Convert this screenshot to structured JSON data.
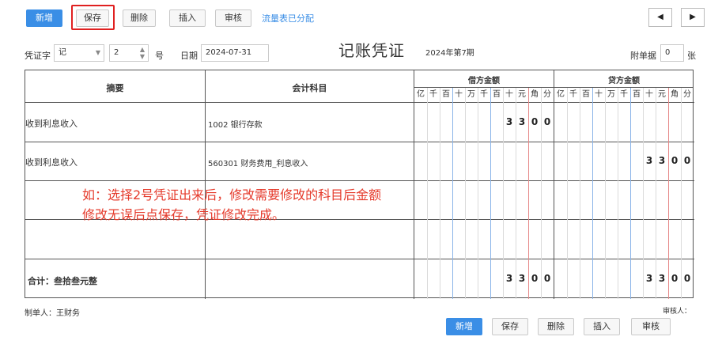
{
  "toolbar": {
    "new_label": "新增",
    "save_label": "保存",
    "delete_label": "删除",
    "insert_label": "插入",
    "review_label": "审核",
    "cashflow_link": "流量表已分配",
    "prev_icon": "◀",
    "next_icon": "▶"
  },
  "header": {
    "voucher_word_label": "凭证字",
    "voucher_word_value": "记",
    "number_value": "2",
    "number_suffix": "号",
    "date_label": "日期",
    "date_value": "2024-07-31",
    "title": "记账凭证",
    "period": "2024年第7期",
    "attachment_label": "附单据",
    "attachment_value": "0",
    "attachment_unit": "张"
  },
  "table": {
    "col_summary": "摘要",
    "col_account": "会计科目",
    "col_debit": "借方金额",
    "col_credit": "贷方金额",
    "units": [
      "亿",
      "千",
      "百",
      "十",
      "万",
      "千",
      "百",
      "十",
      "元",
      "角",
      "分"
    ],
    "rows": [
      {
        "summary": "收到利息收入",
        "account": "1002 银行存款",
        "debit_digits": [
          "3",
          "3",
          "0",
          "0"
        ],
        "credit_digits": []
      },
      {
        "summary": "收到利息收入",
        "account": "560301 财务费用_利息收入",
        "debit_digits": [],
        "credit_digits": [
          "3",
          "3",
          "0",
          "0"
        ]
      },
      {
        "summary": "",
        "account": "",
        "debit_digits": [],
        "credit_digits": []
      },
      {
        "summary": "",
        "account": "",
        "debit_digits": [],
        "credit_digits": []
      }
    ],
    "total_label": "合计：叁拾叁元整",
    "total_debit_digits": [
      "3",
      "3",
      "0",
      "0"
    ],
    "total_credit_digits": [
      "3",
      "3",
      "0",
      "0"
    ]
  },
  "annotation": {
    "line1": "如：选择2号凭证出来后，修改需要修改的科目后金额",
    "line2": "修改无误后点保存，凭证修改完成。"
  },
  "footer": {
    "maker": "制单人：王财务",
    "reviewer": "审核人：",
    "new_label": "新增",
    "save_label": "保存",
    "delete_label": "删除",
    "insert_label": "插入",
    "review_label": "审核"
  }
}
